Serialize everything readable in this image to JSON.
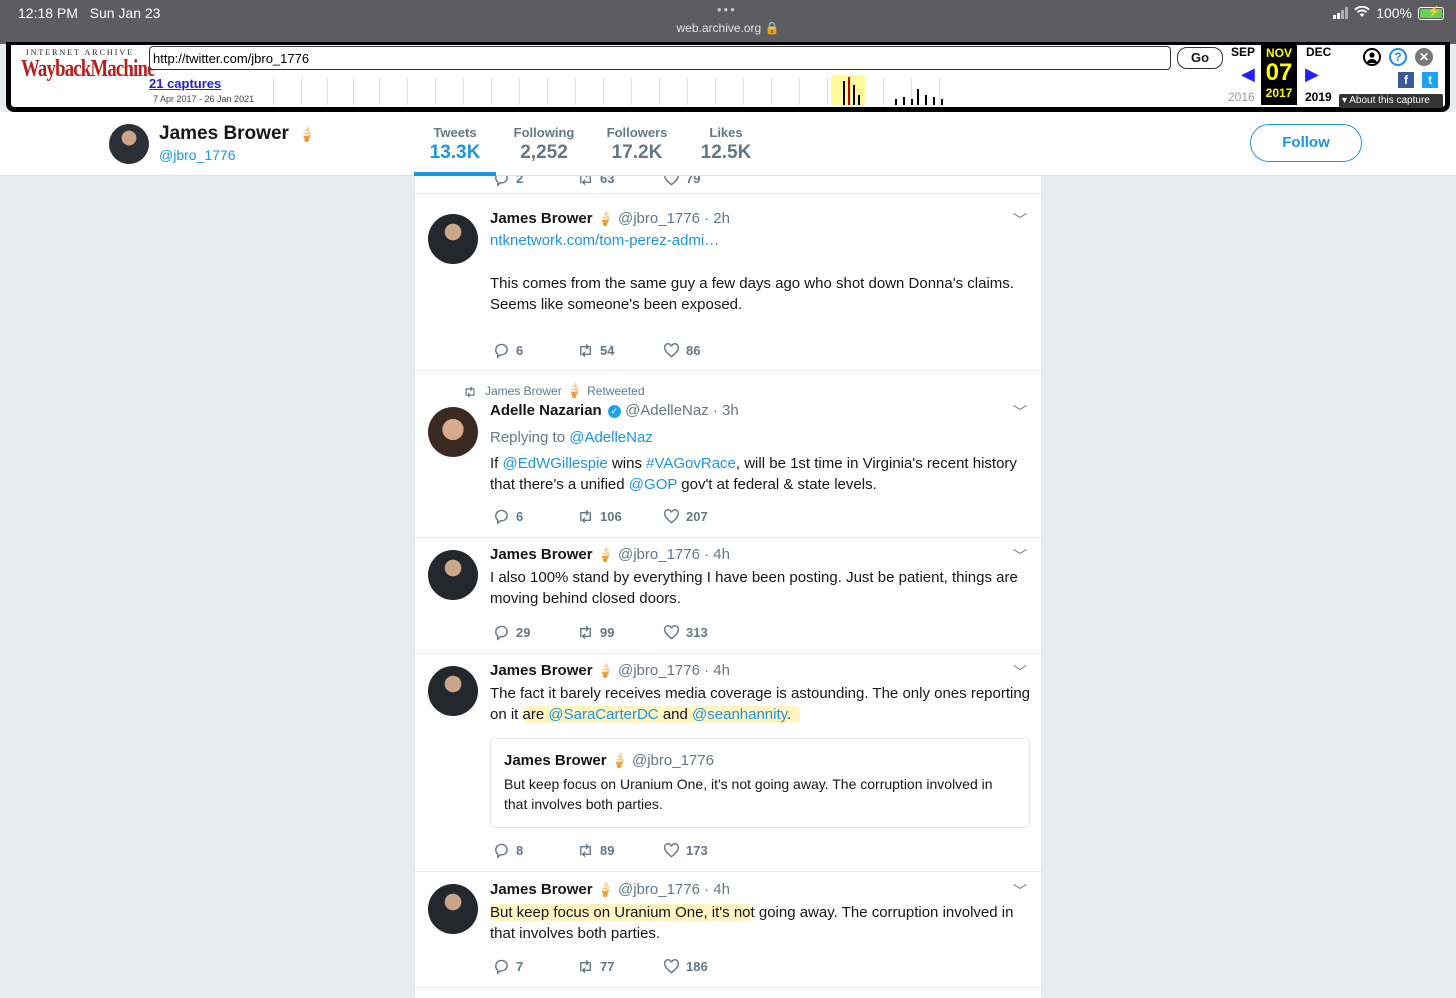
{
  "status_bar": {
    "time": "12:18 PM",
    "date": "Sun Jan 23",
    "url": "web.archive.org 🔒",
    "battery": "100%"
  },
  "wayback": {
    "logo_top": "INTERNET ARCHIVE",
    "logo_main": "WaybackMachine",
    "url_value": "http://twitter.com/jbro_1776",
    "go_label": "Go",
    "captures_label": "21 captures",
    "date_range": "7 Apr 2017 - 26 Jan 2021",
    "prev_month": "SEP",
    "current_month": "NOV",
    "next_month": "DEC",
    "current_day": "07",
    "prev_year": "2016",
    "current_year": "2017",
    "next_year": "2019",
    "about_label": "▾ About this capture"
  },
  "profile": {
    "name": "James Brower",
    "handle": "@jbro_1776",
    "follow_label": "Follow",
    "nav": [
      {
        "label": "Tweets",
        "value": "13.3K"
      },
      {
        "label": "Following",
        "value": "2,252"
      },
      {
        "label": "Followers",
        "value": "17.2K"
      },
      {
        "label": "Likes",
        "value": "12.5K"
      }
    ]
  },
  "tweets": [
    {
      "replies": "2",
      "retweets": "63",
      "likes": "79"
    },
    {
      "name": "James Brower",
      "handle": "@jbro_1776",
      "time": "· 2h",
      "link": "ntknetwork.com/tom-perez-admi…",
      "text": "This comes from the same guy a few days ago who shot down Donna's claims. Seems like someone's been exposed.",
      "replies": "6",
      "retweets": "54",
      "likes": "86"
    },
    {
      "retweeted_by": "James Brower",
      "retweeted_label": "Retweeted",
      "name": "Adelle Nazarian",
      "handle": "@AdelleNaz",
      "time": "· 3h",
      "replying_label": "Replying to",
      "replying_to": "@AdelleNaz",
      "text_parts": [
        "If ",
        "@EdWGillespie",
        " wins ",
        "#VAGovRace",
        ", will be 1st time in Virginia's recent history that there's a unified ",
        "@GOP",
        " gov't at federal & state levels."
      ],
      "replies": "6",
      "retweets": "106",
      "likes": "207"
    },
    {
      "name": "James Brower",
      "handle": "@jbro_1776",
      "time": "· 4h",
      "text": "I also 100% stand by everything I have been posting. Just be patient, things are moving behind closed doors.",
      "replies": "29",
      "retweets": "99",
      "likes": "313"
    },
    {
      "name": "James Brower",
      "handle": "@jbro_1776",
      "time": "· 4h",
      "text_parts": [
        "The fact it barely receives media coverage is astounding. The only ones reporting on it ",
        "are ",
        "@SaraCarterDC",
        " and ",
        "@seanhannity",
        "."
      ],
      "quote": {
        "name": "James Brower",
        "handle": "@jbro_1776",
        "text": "But keep focus on Uranium One, it's not going away. The corruption involved in that involves both parties."
      },
      "replies": "8",
      "retweets": "89",
      "likes": "173"
    },
    {
      "name": "James Brower",
      "handle": "@jbro_1776",
      "time": "· 4h",
      "text_parts": [
        "But keep focus on Uranium One, it's no",
        "t going away. The corruption involved in that involves both parties."
      ],
      "replies": "7",
      "retweets": "77",
      "likes": "186"
    }
  ]
}
